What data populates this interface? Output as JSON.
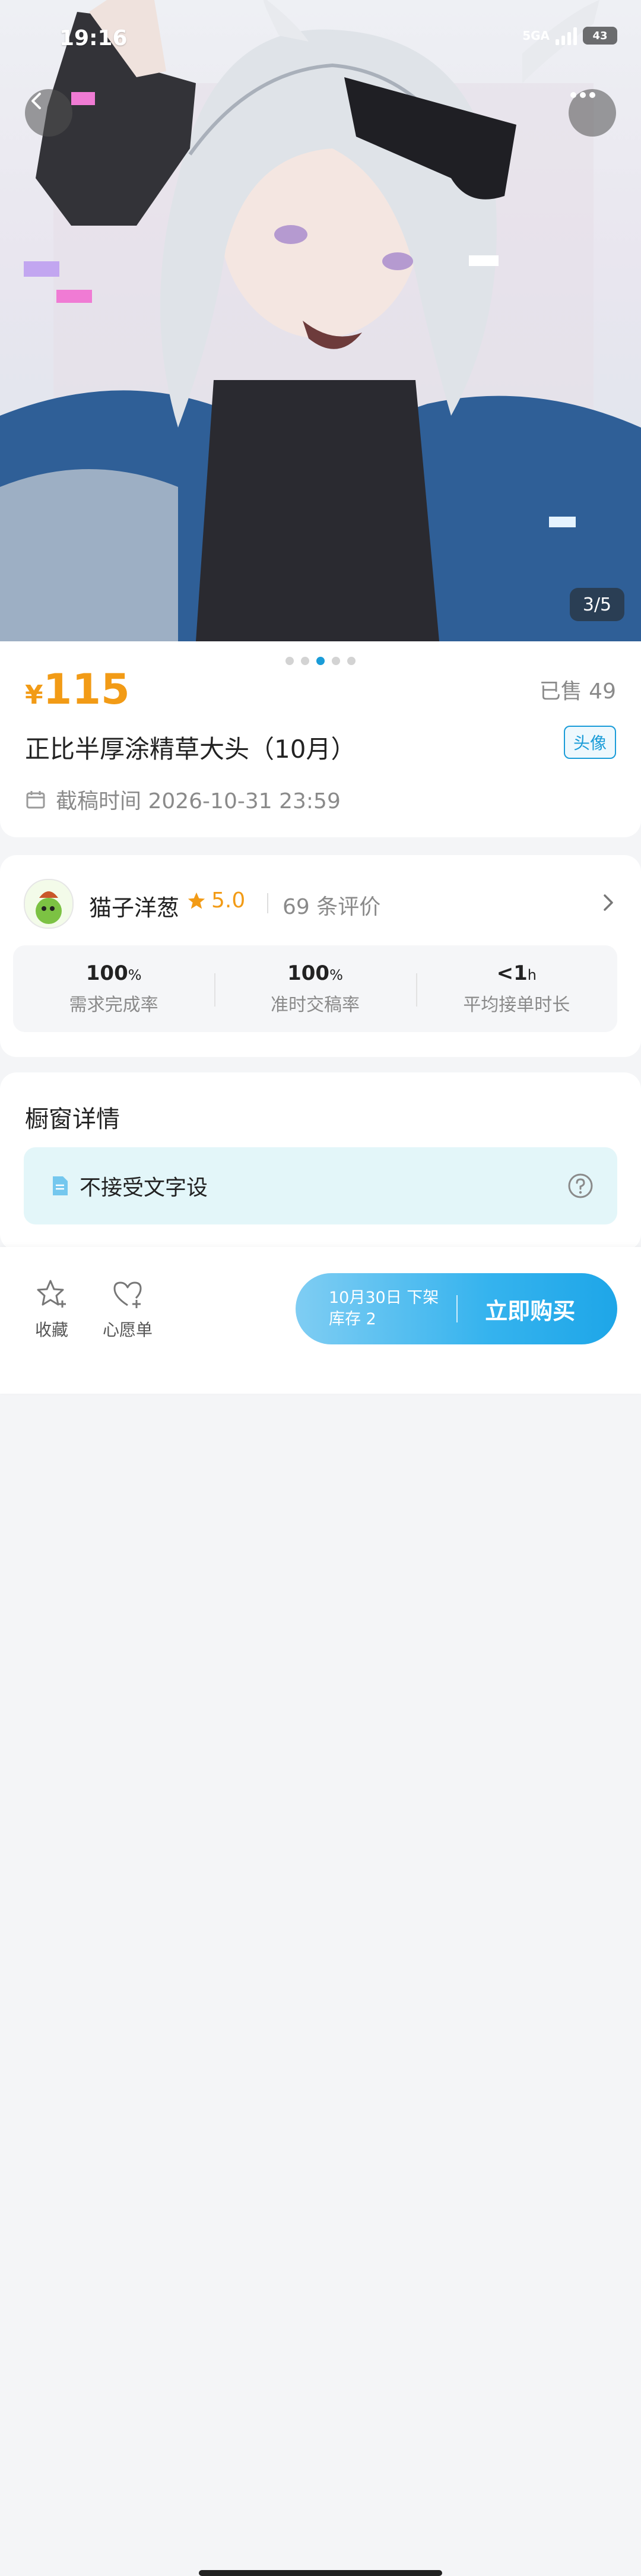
{
  "status_bar": {
    "time": "19:16",
    "network": "5GA",
    "battery": "43"
  },
  "gallery": {
    "counter": "3/5",
    "dot_count": 5,
    "active_dot": 2
  },
  "product": {
    "currency": "¥",
    "price": "115",
    "sold": "已售 49",
    "title": "正比半厚涂精草大头（10月）",
    "tag": "头像",
    "deadline": "截稿时间 2026-10-31 23:59"
  },
  "seller": {
    "name": "猫子洋葱",
    "rating": "5.0",
    "reviews": "69 条评价",
    "stats": [
      {
        "value": "100",
        "unit": "%",
        "label": "需求完成率"
      },
      {
        "value": "100",
        "unit": "%",
        "label": "准时交稿率"
      },
      {
        "value": "<1",
        "unit": "h",
        "label": "平均接单时长"
      }
    ]
  },
  "details": {
    "title": "橱窗详情",
    "notice": "不接受文字设"
  },
  "bottom_bar": {
    "favorite_label": "收藏",
    "wishlist_label": "心愿单",
    "buy_line1": "10月30日 下架",
    "buy_line2": "库存 2",
    "buy_label": "立即购买"
  },
  "colors": {
    "accent": "#1a9cd8",
    "price": "#f29b16"
  }
}
